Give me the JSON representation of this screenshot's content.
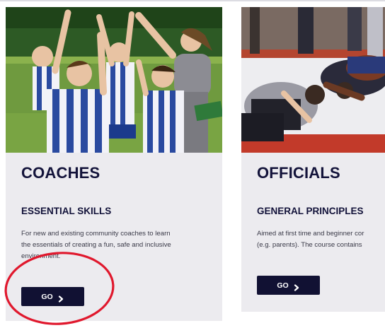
{
  "cards": [
    {
      "title": "COACHES",
      "subtitle": "ESSENTIAL SKILLS",
      "description_lines": [
        "For new and existing community coaches to learn",
        "the essentials of creating a fun, safe and inclusive",
        "environment."
      ],
      "button_label": "GO",
      "button_icon": "chevron-right-icon",
      "image": "kids-team-high-five-with-coach"
    },
    {
      "title": "OFFICIALS",
      "subtitle": "GENERAL PRINCIPLES",
      "description_lines": [
        "Aimed at first time and beginner cor",
        "(e.g. parents). The course contains"
      ],
      "button_label": "GO",
      "button_icon": "chevron-right-icon",
      "image": "wrestling-referee-on-mat"
    }
  ],
  "colors": {
    "card_bg": "#ecebef",
    "title": "#13133a",
    "button_bg": "#111133",
    "annotation": "#e0182d"
  },
  "annotation": "red-circle-around-coaches-go-button"
}
